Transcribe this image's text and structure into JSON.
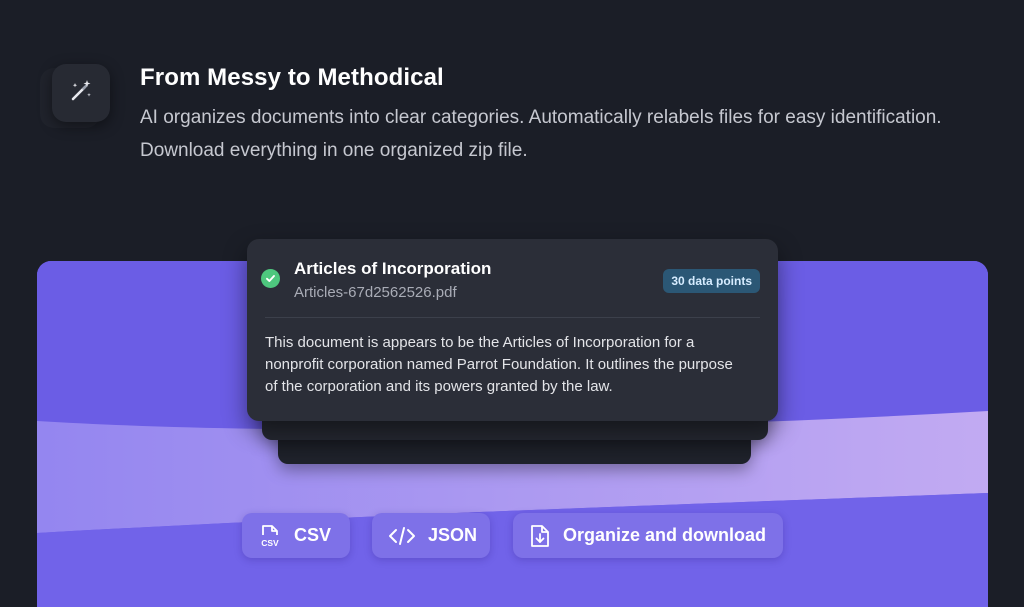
{
  "feature": {
    "icon": "magic-wand-icon",
    "title": "From Messy to Methodical",
    "description": "AI organizes documents into clear categories. Automatically relabels files for easy identification. Download everything in one organized zip file."
  },
  "document_card": {
    "status_icon": "check-circle-icon",
    "title": "Articles of Incorporation",
    "filename": "Articles-67d2562526.pdf",
    "badge": "30 data points",
    "summary": "This document is appears to be the Articles of Incorporation for a nonprofit corporation named Parrot Foundation. It outlines the purpose of the corporation and its powers granted by the law."
  },
  "actions": {
    "csv": {
      "label": "CSV",
      "icon": "csv-file-icon"
    },
    "json": {
      "label": "JSON",
      "icon": "code-icon"
    },
    "organize": {
      "label": "Organize and download",
      "icon": "download-file-icon"
    }
  },
  "colors": {
    "background": "#1b1e27",
    "panel_purple": "#6c5ee6",
    "card": "#2b2e38",
    "check_green": "#4ec77e",
    "badge_bg": "#2b5775"
  }
}
